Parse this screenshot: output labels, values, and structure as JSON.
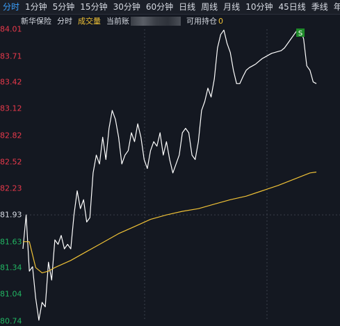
{
  "tabs": [
    {
      "label": "分时",
      "active": true
    },
    {
      "label": "1分钟"
    },
    {
      "label": "5分钟"
    },
    {
      "label": "15分钟"
    },
    {
      "label": "30分钟"
    },
    {
      "label": "60分钟"
    },
    {
      "label": "日线"
    },
    {
      "label": "周线"
    },
    {
      "label": "月线"
    },
    {
      "label": "10分钟"
    },
    {
      "label": "45日线"
    },
    {
      "label": "季线"
    },
    {
      "label": "年"
    }
  ],
  "subbar": {
    "stock_name": "新华保险",
    "mode": "分时",
    "indicator": "成交量",
    "current_label": "当前账",
    "available_label": "可用持仓",
    "available_value": "0"
  },
  "colors": {
    "up": "#e8394b",
    "down": "#22b663",
    "price_line": "#ffffff",
    "avg_line": "#f0c236",
    "accent": "#3aa0ff",
    "signal": "#1f8a2a"
  },
  "chart_data": {
    "type": "line",
    "y_ticks": [
      "84.01",
      "83.71",
      "83.42",
      "83.12",
      "82.82",
      "82.52",
      "82.23",
      "81.93",
      "81.63",
      "81.34",
      "81.04",
      "80.74"
    ],
    "reference_price": 81.93,
    "ylim": [
      80.74,
      84.01
    ],
    "signal_marker": {
      "label": "S",
      "x": 87,
      "price": 84.01
    },
    "series": [
      {
        "key": "price",
        "x": [
          0,
          1,
          2,
          3,
          4,
          5,
          6,
          7,
          8,
          9,
          10,
          11,
          12,
          13,
          14,
          15,
          16,
          17,
          18,
          19,
          20,
          21,
          22,
          23,
          24,
          25,
          26,
          27,
          28,
          29,
          30,
          31,
          32,
          33,
          34,
          35,
          36,
          37,
          38,
          39,
          40,
          41,
          42,
          43,
          44,
          45,
          46,
          47,
          48,
          49,
          50,
          51,
          52,
          53,
          54,
          55,
          56,
          57,
          58,
          59,
          60,
          61,
          62,
          63,
          64,
          65,
          66,
          67,
          68,
          69,
          70,
          71,
          72,
          73,
          74,
          75,
          76,
          77,
          78,
          79,
          80,
          81,
          82,
          83,
          84,
          85,
          86,
          87,
          88,
          89,
          90,
          91,
          92
        ],
        "values": [
          81.55,
          81.93,
          81.3,
          81.35,
          81.0,
          80.75,
          80.95,
          80.9,
          81.4,
          81.2,
          81.65,
          81.6,
          81.7,
          81.55,
          81.6,
          81.55,
          81.93,
          82.2,
          82.0,
          82.1,
          81.85,
          81.9,
          82.4,
          82.6,
          82.5,
          82.8,
          82.55,
          82.9,
          83.1,
          83.0,
          82.8,
          82.5,
          82.6,
          82.65,
          82.85,
          82.75,
          82.95,
          82.8,
          82.55,
          82.45,
          82.65,
          82.75,
          82.7,
          82.85,
          82.6,
          82.75,
          82.55,
          82.4,
          82.5,
          82.6,
          82.85,
          82.9,
          82.85,
          82.6,
          82.55,
          82.75,
          83.1,
          83.2,
          83.35,
          83.25,
          83.45,
          83.8,
          83.95,
          84.0,
          83.85,
          83.75,
          83.55,
          83.4,
          83.4,
          83.48,
          83.55,
          83.58,
          83.6,
          83.62,
          83.65,
          83.68,
          83.7,
          83.72,
          83.74,
          83.75,
          83.76,
          83.77,
          83.8,
          83.85,
          83.9,
          83.95,
          84.0,
          84.01,
          83.9,
          83.6,
          83.55,
          83.42,
          83.4
        ]
      },
      {
        "key": "average",
        "x": [
          0,
          2,
          4,
          6,
          8,
          10,
          15,
          20,
          25,
          30,
          35,
          40,
          45,
          50,
          55,
          60,
          65,
          70,
          75,
          80,
          85,
          90,
          92
        ],
        "values": [
          81.63,
          81.63,
          81.34,
          81.28,
          81.3,
          81.34,
          81.42,
          81.52,
          81.62,
          81.72,
          81.8,
          81.88,
          81.93,
          81.97,
          82.0,
          82.05,
          82.1,
          82.14,
          82.2,
          82.26,
          82.33,
          82.4,
          82.41
        ]
      }
    ]
  }
}
